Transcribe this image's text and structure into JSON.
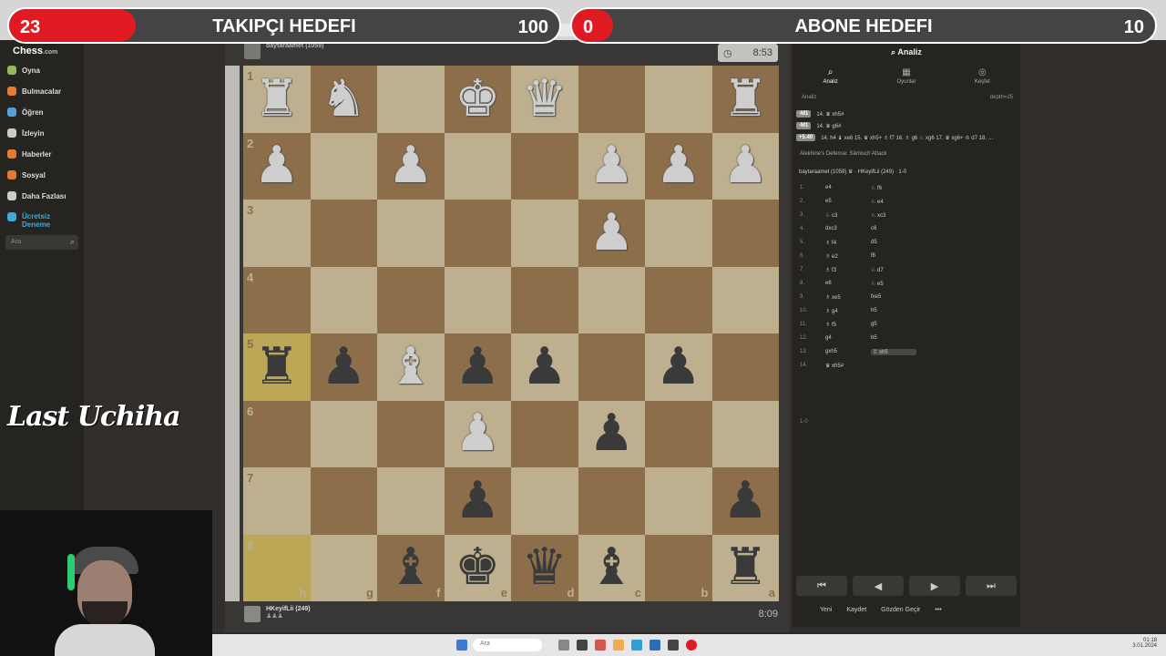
{
  "overlays": {
    "follower_goal": {
      "current": "23",
      "label": "TAKIPÇI HEDEFI",
      "target": "100",
      "progress": 0.23
    },
    "subscriber_goal": {
      "current": "0",
      "label": "ABONE HEDEFI",
      "target": "10",
      "progress": 0.0
    }
  },
  "sidebar": {
    "logo": "Chess",
    "logo_suffix": ".com",
    "items": [
      {
        "label": "Oyna",
        "icon": "play-icon",
        "color": "#8fbc5a"
      },
      {
        "label": "Bulmacalar",
        "icon": "puzzle-icon",
        "color": "#e57a33"
      },
      {
        "label": "Öğren",
        "icon": "learn-icon",
        "color": "#5aa0d8"
      },
      {
        "label": "İzleyin",
        "icon": "watch-icon",
        "color": "#ccc"
      },
      {
        "label": "Haberler",
        "icon": "news-icon",
        "color": "#e57a33"
      },
      {
        "label": "Sosyal",
        "icon": "social-icon",
        "color": "#e57a33"
      },
      {
        "label": "Daha Fazlası",
        "icon": "more-icon",
        "color": "#ccc"
      },
      {
        "label": "Ücretsiz Deneme",
        "icon": "diamond-icon",
        "color": "#41a8d8"
      }
    ],
    "search_placeholder": "Ara"
  },
  "streamer_name": "Last Uchiha",
  "players": {
    "top": {
      "name": "baytaraamet (1059)",
      "sub": "",
      "clock": "8:53"
    },
    "bottom": {
      "name": "HKeyifLii (249)",
      "sub": "♟♟♟",
      "clock": "8:09"
    }
  },
  "board": {
    "ranks": [
      "1",
      "2",
      "3",
      "4",
      "5",
      "6",
      "7",
      "8"
    ],
    "files": [
      "h",
      "g",
      "f",
      "e",
      "d",
      "c",
      "b",
      "a"
    ],
    "position": [
      [
        "wR",
        "wN",
        "",
        "wK",
        "wQ",
        "",
        "",
        "wR"
      ],
      [
        "wP",
        "",
        "wP",
        "",
        "",
        "wP",
        "wP",
        "wP"
      ],
      [
        "",
        "",
        "",
        "",
        "",
        "wP",
        "",
        ""
      ],
      [
        "",
        "",
        "",
        "",
        "",
        "",
        "",
        ""
      ],
      [
        "bR",
        "bP",
        "wB",
        "bP",
        "bP",
        "",
        "bP",
        ""
      ],
      [
        "",
        "",
        "",
        "wP",
        "",
        "bP",
        "",
        ""
      ],
      [
        "",
        "",
        "",
        "bP",
        "",
        "",
        "",
        "bP"
      ],
      [
        "",
        "",
        "bB",
        "bK",
        "bQ",
        "bB",
        "",
        "bR"
      ]
    ],
    "highlight": [
      [
        4,
        0
      ],
      [
        7,
        0
      ]
    ]
  },
  "panel": {
    "title": "Analiz",
    "tabs": [
      {
        "label": "Analiz",
        "icon": "search-icon"
      },
      {
        "label": "Oyunlar",
        "icon": "games-icon"
      },
      {
        "label": "Keşfet",
        "icon": "explore-icon"
      }
    ],
    "sub_left": "Analiz",
    "sub_right": "depth=25",
    "engine_lines": [
      {
        "score": "-M1",
        "line": "14. ♛ xh5#"
      },
      {
        "score": "-M1",
        "line": "14. ♛ g6#"
      },
      {
        "score": "+5.40",
        "line": "14. h4 ♝ xe6 15. ♛ xh5+ ♗ f7 16. ♗ g6 ♘ xg6 17. ♛ xg6+ ♔ d7 18. …"
      }
    ],
    "opening": "Alekhine's Defense: Sämisch Attack",
    "game_header": "baytaraamet (1059) ♛ · HKeyifLii (249) · 1-0",
    "moves": [
      {
        "n": "1.",
        "w": "e4",
        "b": "♘ f6"
      },
      {
        "n": "2.",
        "w": "e5",
        "b": "♘ e4"
      },
      {
        "n": "3.",
        "w": "♘ c3",
        "b": "♘ xc3"
      },
      {
        "n": "4.",
        "w": "dxc3",
        "b": "c6"
      },
      {
        "n": "5.",
        "w": "♗ f4",
        "b": "d5"
      },
      {
        "n": "6.",
        "w": "♗ e2",
        "b": "f6"
      },
      {
        "n": "7.",
        "w": "♗ f3",
        "b": "♘ d7"
      },
      {
        "n": "8.",
        "w": "e6",
        "b": "♘ e5"
      },
      {
        "n": "9.",
        "w": "♗ xe5",
        "b": "fxe5"
      },
      {
        "n": "10.",
        "w": "♗ g4",
        "b": "h5"
      },
      {
        "n": "11.",
        "w": "♗ f5",
        "b": "g5"
      },
      {
        "n": "12.",
        "w": "g4",
        "b": "b5"
      },
      {
        "n": "13.",
        "w": "gxh5",
        "b": "♖ xh5"
      },
      {
        "n": "14.",
        "w": "♛ xh5#",
        "b": ""
      }
    ],
    "result": "1-0",
    "nav": [
      "⏮",
      "◀",
      "▶",
      "⏭"
    ],
    "actions": [
      {
        "label": "Yeni",
        "icon": "new-icon"
      },
      {
        "label": "Kaydet",
        "icon": "save-icon"
      },
      {
        "label": "Gözden Geçir",
        "icon": "review-icon"
      },
      {
        "label": "•••",
        "icon": "more-icon"
      }
    ]
  },
  "taskbar": {
    "search": "Ara",
    "time": "01:18",
    "date": "3.01.2024"
  }
}
